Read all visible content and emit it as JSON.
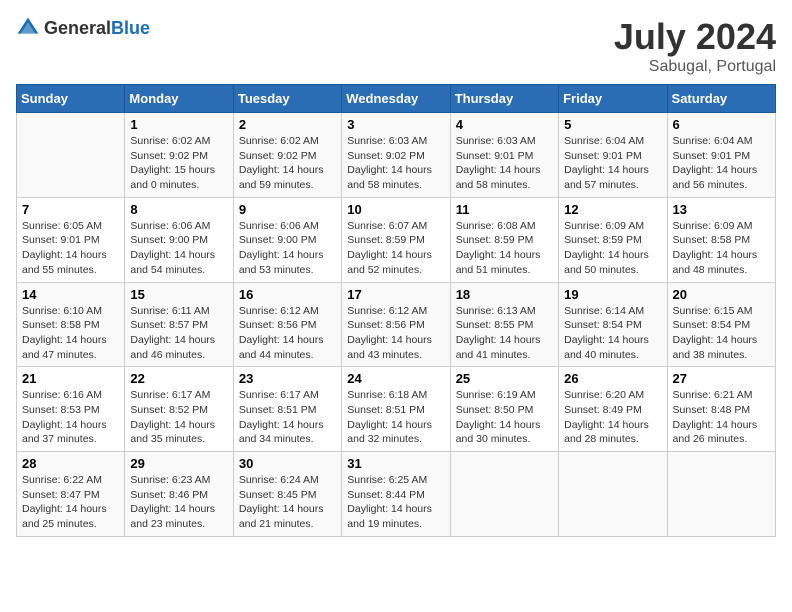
{
  "header": {
    "logo_general": "General",
    "logo_blue": "Blue",
    "month": "July 2024",
    "location": "Sabugal, Portugal"
  },
  "days_of_week": [
    "Sunday",
    "Monday",
    "Tuesday",
    "Wednesday",
    "Thursday",
    "Friday",
    "Saturday"
  ],
  "weeks": [
    [
      {
        "day": "",
        "info": ""
      },
      {
        "day": "1",
        "info": "Sunrise: 6:02 AM\nSunset: 9:02 PM\nDaylight: 15 hours\nand 0 minutes."
      },
      {
        "day": "2",
        "info": "Sunrise: 6:02 AM\nSunset: 9:02 PM\nDaylight: 14 hours\nand 59 minutes."
      },
      {
        "day": "3",
        "info": "Sunrise: 6:03 AM\nSunset: 9:02 PM\nDaylight: 14 hours\nand 58 minutes."
      },
      {
        "day": "4",
        "info": "Sunrise: 6:03 AM\nSunset: 9:01 PM\nDaylight: 14 hours\nand 58 minutes."
      },
      {
        "day": "5",
        "info": "Sunrise: 6:04 AM\nSunset: 9:01 PM\nDaylight: 14 hours\nand 57 minutes."
      },
      {
        "day": "6",
        "info": "Sunrise: 6:04 AM\nSunset: 9:01 PM\nDaylight: 14 hours\nand 56 minutes."
      }
    ],
    [
      {
        "day": "7",
        "info": "Sunrise: 6:05 AM\nSunset: 9:01 PM\nDaylight: 14 hours\nand 55 minutes."
      },
      {
        "day": "8",
        "info": "Sunrise: 6:06 AM\nSunset: 9:00 PM\nDaylight: 14 hours\nand 54 minutes."
      },
      {
        "day": "9",
        "info": "Sunrise: 6:06 AM\nSunset: 9:00 PM\nDaylight: 14 hours\nand 53 minutes."
      },
      {
        "day": "10",
        "info": "Sunrise: 6:07 AM\nSunset: 8:59 PM\nDaylight: 14 hours\nand 52 minutes."
      },
      {
        "day": "11",
        "info": "Sunrise: 6:08 AM\nSunset: 8:59 PM\nDaylight: 14 hours\nand 51 minutes."
      },
      {
        "day": "12",
        "info": "Sunrise: 6:09 AM\nSunset: 8:59 PM\nDaylight: 14 hours\nand 50 minutes."
      },
      {
        "day": "13",
        "info": "Sunrise: 6:09 AM\nSunset: 8:58 PM\nDaylight: 14 hours\nand 48 minutes."
      }
    ],
    [
      {
        "day": "14",
        "info": "Sunrise: 6:10 AM\nSunset: 8:58 PM\nDaylight: 14 hours\nand 47 minutes."
      },
      {
        "day": "15",
        "info": "Sunrise: 6:11 AM\nSunset: 8:57 PM\nDaylight: 14 hours\nand 46 minutes."
      },
      {
        "day": "16",
        "info": "Sunrise: 6:12 AM\nSunset: 8:56 PM\nDaylight: 14 hours\nand 44 minutes."
      },
      {
        "day": "17",
        "info": "Sunrise: 6:12 AM\nSunset: 8:56 PM\nDaylight: 14 hours\nand 43 minutes."
      },
      {
        "day": "18",
        "info": "Sunrise: 6:13 AM\nSunset: 8:55 PM\nDaylight: 14 hours\nand 41 minutes."
      },
      {
        "day": "19",
        "info": "Sunrise: 6:14 AM\nSunset: 8:54 PM\nDaylight: 14 hours\nand 40 minutes."
      },
      {
        "day": "20",
        "info": "Sunrise: 6:15 AM\nSunset: 8:54 PM\nDaylight: 14 hours\nand 38 minutes."
      }
    ],
    [
      {
        "day": "21",
        "info": "Sunrise: 6:16 AM\nSunset: 8:53 PM\nDaylight: 14 hours\nand 37 minutes."
      },
      {
        "day": "22",
        "info": "Sunrise: 6:17 AM\nSunset: 8:52 PM\nDaylight: 14 hours\nand 35 minutes."
      },
      {
        "day": "23",
        "info": "Sunrise: 6:17 AM\nSunset: 8:51 PM\nDaylight: 14 hours\nand 34 minutes."
      },
      {
        "day": "24",
        "info": "Sunrise: 6:18 AM\nSunset: 8:51 PM\nDaylight: 14 hours\nand 32 minutes."
      },
      {
        "day": "25",
        "info": "Sunrise: 6:19 AM\nSunset: 8:50 PM\nDaylight: 14 hours\nand 30 minutes."
      },
      {
        "day": "26",
        "info": "Sunrise: 6:20 AM\nSunset: 8:49 PM\nDaylight: 14 hours\nand 28 minutes."
      },
      {
        "day": "27",
        "info": "Sunrise: 6:21 AM\nSunset: 8:48 PM\nDaylight: 14 hours\nand 26 minutes."
      }
    ],
    [
      {
        "day": "28",
        "info": "Sunrise: 6:22 AM\nSunset: 8:47 PM\nDaylight: 14 hours\nand 25 minutes."
      },
      {
        "day": "29",
        "info": "Sunrise: 6:23 AM\nSunset: 8:46 PM\nDaylight: 14 hours\nand 23 minutes."
      },
      {
        "day": "30",
        "info": "Sunrise: 6:24 AM\nSunset: 8:45 PM\nDaylight: 14 hours\nand 21 minutes."
      },
      {
        "day": "31",
        "info": "Sunrise: 6:25 AM\nSunset: 8:44 PM\nDaylight: 14 hours\nand 19 minutes."
      },
      {
        "day": "",
        "info": ""
      },
      {
        "day": "",
        "info": ""
      },
      {
        "day": "",
        "info": ""
      }
    ]
  ]
}
